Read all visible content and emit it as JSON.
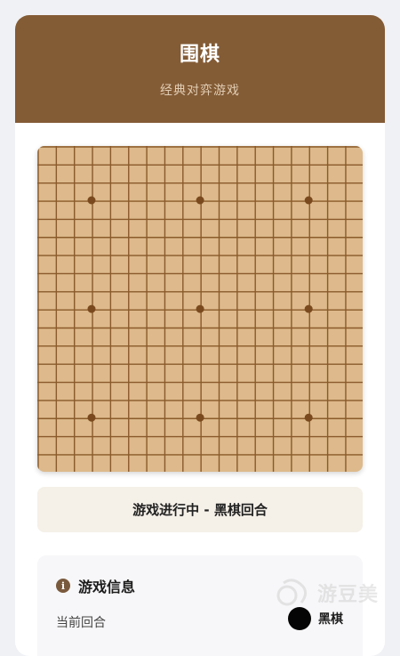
{
  "header": {
    "title": "围棋",
    "subtitle": "经典对弈游戏"
  },
  "board": {
    "size": 19,
    "star_points": [
      [
        3,
        3
      ],
      [
        3,
        9
      ],
      [
        3,
        15
      ],
      [
        9,
        3
      ],
      [
        9,
        9
      ],
      [
        9,
        15
      ],
      [
        15,
        3
      ],
      [
        15,
        9
      ],
      [
        15,
        15
      ]
    ],
    "stones": [],
    "colors": {
      "board": "#ddb98b",
      "line": "#8a5a2b",
      "star": "#7a4a1e"
    }
  },
  "status": {
    "text": "游戏进行中 - 黑棋回合"
  },
  "info": {
    "title": "游戏信息",
    "icon": "info-icon",
    "turn_label": "当前回合",
    "turn_value": "黑棋",
    "turn_stone_color": "#050505"
  },
  "watermark": {
    "text": "游豆美"
  }
}
